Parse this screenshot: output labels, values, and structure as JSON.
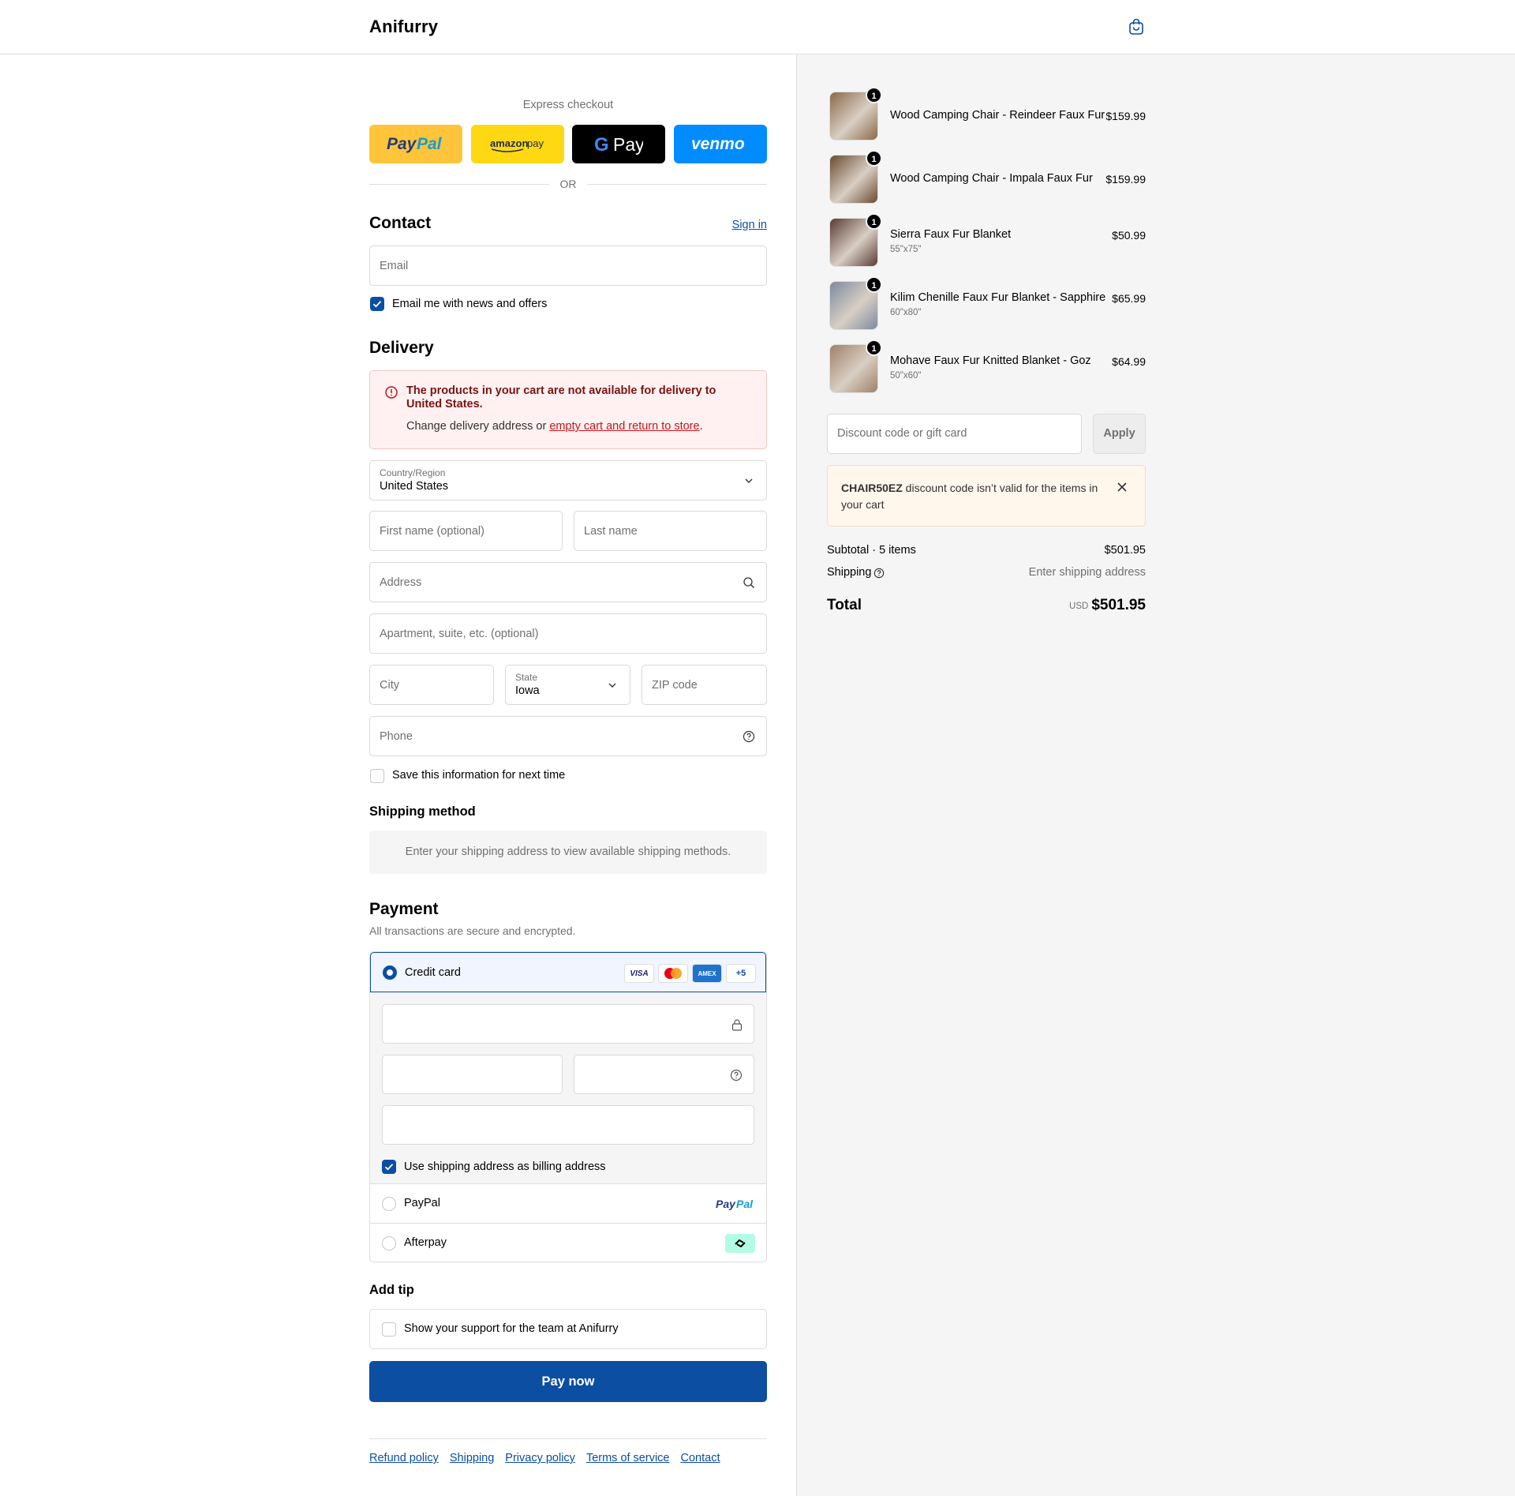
{
  "header": {
    "brand": "Anifurry",
    "bag_icon": "shopping-bag-icon"
  },
  "express": {
    "title": "Express checkout",
    "buttons": [
      "PayPal",
      "amazon pay",
      "G Pay",
      "venmo"
    ],
    "or": "OR"
  },
  "contact": {
    "heading": "Contact",
    "sign_in": "Sign in",
    "email_placeholder": "Email",
    "news_label": "Email me with news and offers"
  },
  "delivery": {
    "heading": "Delivery",
    "alert_title": "The products in your cart are not available for delivery to United States.",
    "alert_body_prefix": "Change delivery address or ",
    "alert_link": "empty cart and return to store",
    "alert_body_suffix": ".",
    "country_label": "Country/Region",
    "country_value": "United States",
    "first_name": "First name (optional)",
    "last_name": "Last name",
    "address": "Address",
    "apartment": "Apartment, suite, etc. (optional)",
    "city": "City",
    "state_label": "State",
    "state_value": "Iowa",
    "zip": "ZIP code",
    "phone": "Phone",
    "save_info": "Save this information for next time"
  },
  "shipping_method": {
    "heading": "Shipping method",
    "info": "Enter your shipping address to view available shipping methods."
  },
  "payment": {
    "heading": "Payment",
    "subtitle": "All transactions are secure and encrypted.",
    "credit_card": "Credit card",
    "card_badges": [
      "VISA",
      "Mastercard",
      "AMEX",
      "+5"
    ],
    "billing_label": "Use shipping address as billing address",
    "paypal": "PayPal",
    "paypal_logo": "PayPal",
    "afterpay": "Afterpay"
  },
  "tip": {
    "heading": "Add tip",
    "label": "Show your support for the team at Anifurry"
  },
  "pay_now": "Pay now",
  "footer_links": [
    "Refund policy",
    "Shipping",
    "Privacy policy",
    "Terms of service",
    "Contact"
  ],
  "cart": {
    "items": [
      {
        "qty": "1",
        "name": "Wood Camping Chair - Reindeer Faux Fur",
        "variant": "",
        "price": "$159.99",
        "thumb": "#8a6a48"
      },
      {
        "qty": "1",
        "name": "Wood Camping Chair - Impala Faux Fur",
        "variant": "",
        "price": "$159.99",
        "thumb": "#6b4a30"
      },
      {
        "qty": "1",
        "name": "Sierra Faux Fur Blanket",
        "variant": "55\"x75\"",
        "price": "$50.99",
        "thumb": "#5a3a34"
      },
      {
        "qty": "1",
        "name": "Kilim Chenille Faux Fur Blanket - Sapphire",
        "variant": "60\"x80\"",
        "price": "$65.99",
        "thumb": "#7d8aa0"
      },
      {
        "qty": "1",
        "name": "Mohave Faux Fur Knitted Blanket - Goz",
        "variant": "50\"x60\"",
        "price": "$64.99",
        "thumb": "#a08068"
      }
    ],
    "discount_placeholder": "Discount code or gift card",
    "apply": "Apply",
    "warning_code": "CHAIR50EZ",
    "warning_text": " discount code isn’t valid for the items in your cart",
    "subtotal_label": "Subtotal · 5 items",
    "subtotal_value": "$501.95",
    "shipping_label": "Shipping",
    "shipping_value": "Enter shipping address",
    "total_label": "Total",
    "currency": "USD",
    "total_value": "$501.95"
  }
}
